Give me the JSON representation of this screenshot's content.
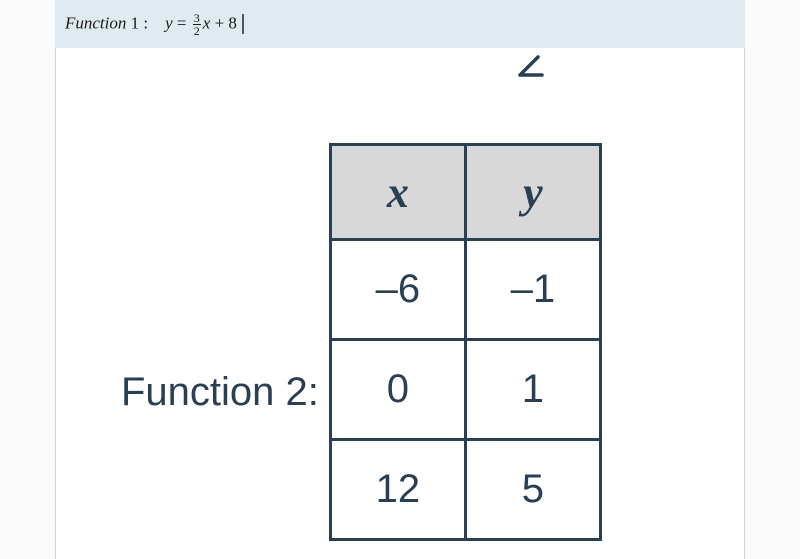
{
  "function1": {
    "label": "Function",
    "number": "1",
    "colon": ":",
    "var_y": "y",
    "equals": "=",
    "frac_num": "3",
    "frac_den": "2",
    "var_x": "x",
    "plus": "+",
    "constant": "8"
  },
  "stray": "∠",
  "function2": {
    "label": "Function 2:",
    "headers": {
      "col1": "x",
      "col2": "y"
    },
    "rows": [
      {
        "x": "–6",
        "y": "–1"
      },
      {
        "x": "0",
        "y": "1"
      },
      {
        "x": "12",
        "y": "5"
      }
    ]
  },
  "chart_data": {
    "type": "table",
    "title": "Function 2",
    "columns": [
      "x",
      "y"
    ],
    "rows": [
      [
        -6,
        -1
      ],
      [
        0,
        1
      ],
      [
        12,
        5
      ]
    ]
  }
}
